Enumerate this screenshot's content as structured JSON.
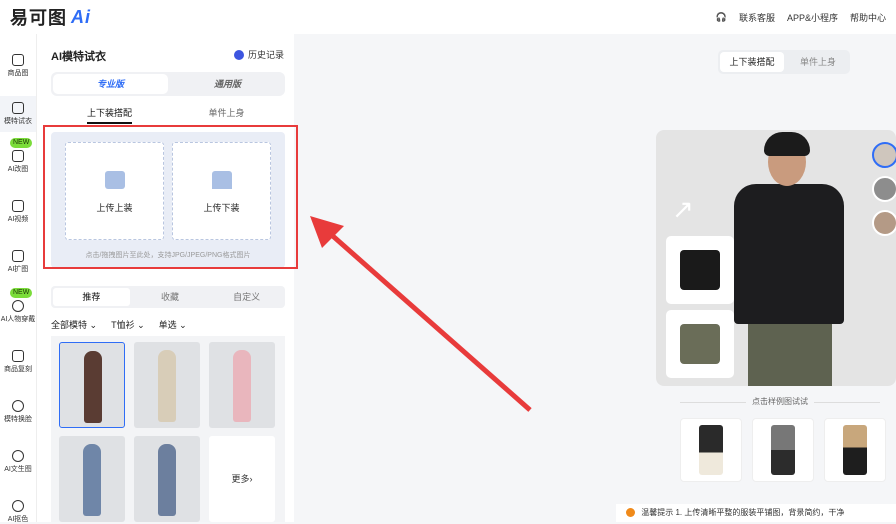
{
  "header": {
    "logo_text": "易可图",
    "logo_ai": "Ai",
    "links": [
      "联系客服",
      "APP&小程序",
      "帮助中心"
    ]
  },
  "sidebar": {
    "items": [
      {
        "label": "商品图",
        "icon": "image-icon"
      },
      {
        "label": "模特试衣",
        "icon": "shirt-icon"
      },
      {
        "label": "AI改图",
        "icon": "edit-image-icon"
      },
      {
        "label": "AI视频",
        "icon": "video-icon"
      },
      {
        "label": "AI扩图",
        "icon": "expand-icon"
      },
      {
        "label": "AI人物穿戴",
        "icon": "necklace-icon"
      },
      {
        "label": "商品复刻",
        "icon": "copy-icon"
      },
      {
        "label": "模特换脸",
        "icon": "face-icon"
      },
      {
        "label": "AI文生图",
        "icon": "text-image-icon"
      },
      {
        "label": "AI抠色",
        "icon": "color-drop-icon"
      }
    ],
    "new_badge": "NEW"
  },
  "panel": {
    "title": "AI模特试衣",
    "history": "历史记录",
    "versions": [
      "专业版",
      "通用版"
    ],
    "subtabs": [
      "上下装搭配",
      "单件上身"
    ],
    "upload_top": "上传上装",
    "upload_bottom": "上传下装",
    "upload_hint": "点击/拖拽图片至此处，支持JPG/JPEG/PNG格式图片",
    "tabs": [
      "推荐",
      "收藏",
      "自定义"
    ],
    "filters": [
      "全部模特",
      "T恤衫",
      "单选"
    ],
    "more": "更多"
  },
  "main": {
    "modes": [
      "上下装搭配",
      "单件上身"
    ],
    "sample_label": "点击样例图试试",
    "tip_title": "温馨提示",
    "tip_text": "1. 上传清晰平整的服装平铺图，背景简约，干净"
  },
  "colors": {
    "accent": "#2f6df6",
    "annotation": "#e83b3b",
    "new_badge": "#7bdc3a"
  }
}
